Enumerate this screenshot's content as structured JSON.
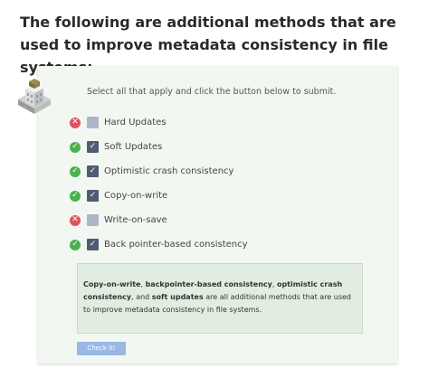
{
  "question": {
    "title": "The following are additional methods that are used to improve metadata consistency in file systems:"
  },
  "quiz": {
    "instructions": "Select all that apply and click the button below to submit.",
    "options": [
      {
        "label": "Hard Updates",
        "checked": false,
        "status": "incorrect"
      },
      {
        "label": "Soft Updates",
        "checked": true,
        "status": "correct"
      },
      {
        "label": "Optimistic crash consistency",
        "checked": true,
        "status": "correct"
      },
      {
        "label": "Copy-on-write",
        "checked": true,
        "status": "correct"
      },
      {
        "label": "Write-on-save",
        "checked": false,
        "status": "incorrect"
      },
      {
        "label": "Back pointer-based consistency",
        "checked": true,
        "status": "correct"
      }
    ],
    "feedback": {
      "b1": "Copy-on-write",
      "t1": ", ",
      "b2": "backpointer-based consistency",
      "t2": ", ",
      "b3": "optimistic crash consistency",
      "t3": ", and ",
      "b4": "soft updates",
      "t4": " are all additional methods that are used to improve metadata consistency in file systems."
    },
    "button_label": "Check it!"
  },
  "colors": {
    "card_background": "#f2f7f2",
    "correct": "#4caf50",
    "incorrect": "#e0525f",
    "checkbox_checked": "#4f5d74",
    "checkbox_unchecked": "#aeb6c6",
    "feedback_background": "#e1ede1",
    "button": "#9ab8e4"
  },
  "icons": {
    "correct": "check-circle-icon",
    "incorrect": "x-circle-icon",
    "checkbox": "checkmark-icon",
    "mascot": "building-icon"
  }
}
